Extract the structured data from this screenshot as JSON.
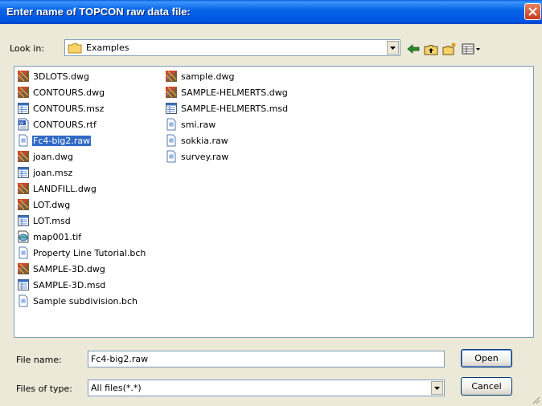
{
  "dialog": {
    "title": "Enter name of TOPCON raw data file:",
    "lookin_label": "Look in:",
    "lookin_value": "Examples",
    "filename_label": "File name:",
    "filename_value": "Fc4-big2.raw",
    "filetype_label": "Files of type:",
    "filetype_value": "All files(*.*)",
    "open_label": "Open",
    "cancel_label": "Cancel"
  },
  "files_col1": [
    {
      "name": "3DLOTS.dwg",
      "icon": "dwg-file-icon"
    },
    {
      "name": "CONTOURS.dwg",
      "icon": "dwg-file-icon"
    },
    {
      "name": "CONTOURS.msz",
      "icon": "data-file-icon"
    },
    {
      "name": "CONTOURS.rtf",
      "icon": "rtf-file-icon"
    },
    {
      "name": "Fc4-big2.raw",
      "icon": "generic-file-icon",
      "selected": true
    },
    {
      "name": "joan.dwg",
      "icon": "dwg-file-icon"
    },
    {
      "name": "joan.msz",
      "icon": "data-file-icon"
    },
    {
      "name": "LANDFILL.dwg",
      "icon": "dwg-file-icon"
    },
    {
      "name": "LOT.dwg",
      "icon": "dwg-file-icon"
    },
    {
      "name": "LOT.msd",
      "icon": "data-file-icon"
    },
    {
      "name": "map001.tif",
      "icon": "image-file-icon"
    },
    {
      "name": "Property Line Tutorial.bch",
      "icon": "generic-file-icon"
    },
    {
      "name": "SAMPLE-3D.dwg",
      "icon": "dwg-file-icon"
    },
    {
      "name": "SAMPLE-3D.msd",
      "icon": "data-file-icon"
    },
    {
      "name": "Sample subdivision.bch",
      "icon": "generic-file-icon"
    }
  ],
  "files_col2": [
    {
      "name": "sample.dwg",
      "icon": "dwg-file-icon"
    },
    {
      "name": "SAMPLE-HELMERTS.dwg",
      "icon": "dwg-file-icon"
    },
    {
      "name": "SAMPLE-HELMERTS.msd",
      "icon": "data-file-icon"
    },
    {
      "name": "smi.raw",
      "icon": "generic-file-icon"
    },
    {
      "name": "sokkia.raw",
      "icon": "generic-file-icon"
    },
    {
      "name": "survey.raw",
      "icon": "generic-file-icon"
    }
  ],
  "colors": {
    "titlebar": "#0054e3",
    "selection": "#316ac5",
    "dialog_bg": "#ece9d8"
  }
}
